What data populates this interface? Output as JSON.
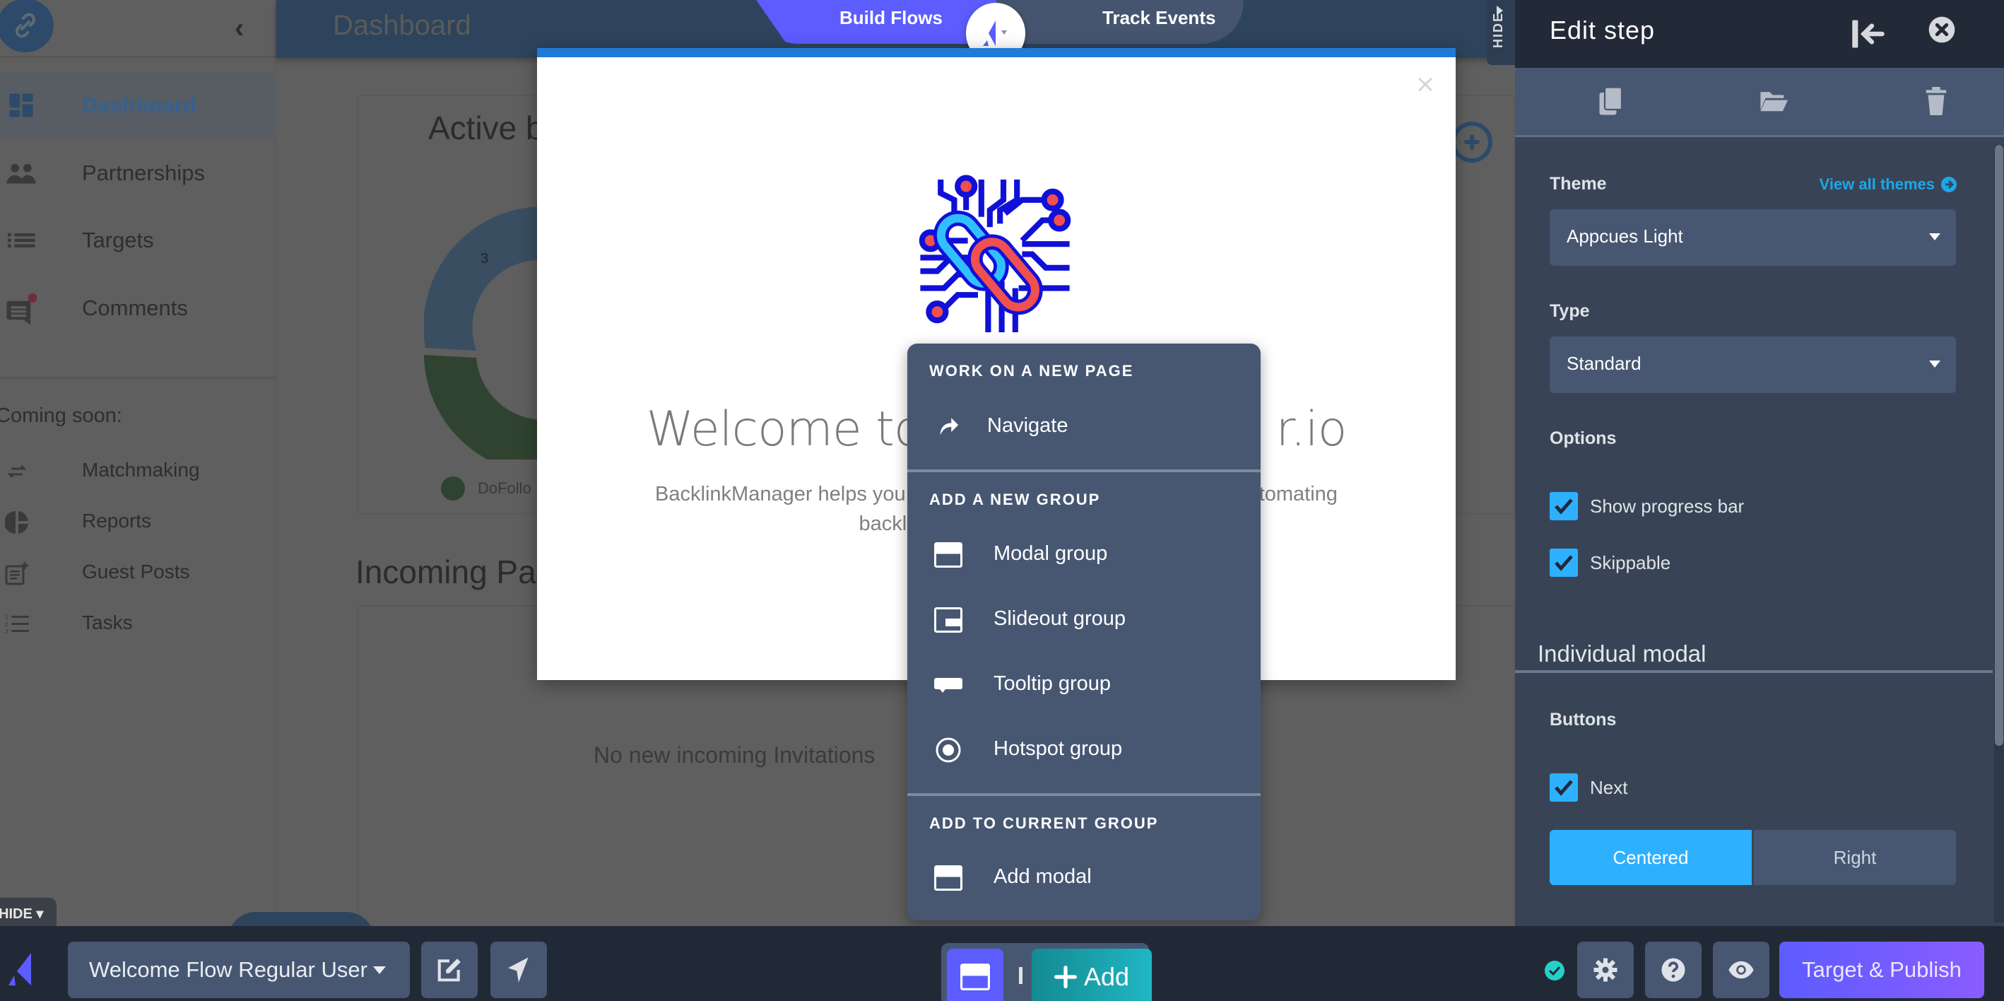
{
  "app": {
    "page_title": "Dashboard",
    "sidebar": {
      "items": [
        {
          "label": "Dashboard",
          "icon": "dashboard-icon",
          "active": true
        },
        {
          "label": "Partnerships",
          "icon": "people-icon"
        },
        {
          "label": "Targets",
          "icon": "list-icon"
        },
        {
          "label": "Comments",
          "icon": "comment-icon",
          "badge": true
        }
      ],
      "coming_soon_label": "Coming soon:",
      "coming_soon": [
        {
          "label": "Matchmaking",
          "icon": "swap-arrows-icon"
        },
        {
          "label": "Reports",
          "icon": "pie-chart-icon"
        },
        {
          "label": "Guest Posts",
          "icon": "post-add-icon"
        },
        {
          "label": "Tasks",
          "icon": "numbered-list-icon"
        }
      ]
    },
    "active_card": {
      "title_visible": "Active b",
      "donut_label": "3",
      "legend_visible": "DoFollo"
    },
    "incoming": {
      "title_visible": "Incoming Pa",
      "empty_text": "No new incoming Invitations"
    },
    "hide_label": "HIDE"
  },
  "mode_switch": {
    "build": "Build Flows",
    "track": "Track Events"
  },
  "welcome_modal": {
    "close": "×",
    "heading_left": "Welcome to",
    "heading_right": "r.io",
    "body_left": "BacklinkManager helps you",
    "body_right": "tomating",
    "body_line2": "backlink b"
  },
  "add_menu": {
    "sections": [
      {
        "title": "WORK ON A NEW PAGE",
        "items": [
          {
            "label": "Navigate",
            "icon": "navigate-arrow-icon"
          }
        ]
      },
      {
        "title": "ADD A NEW GROUP",
        "items": [
          {
            "label": "Modal group",
            "icon": "modal-icon"
          },
          {
            "label": "Slideout group",
            "icon": "slideout-icon"
          },
          {
            "label": "Tooltip group",
            "icon": "tooltip-icon"
          },
          {
            "label": "Hotspot group",
            "icon": "hotspot-icon"
          }
        ]
      },
      {
        "title": "ADD TO CURRENT GROUP",
        "items": [
          {
            "label": "Add modal",
            "icon": "modal-icon"
          }
        ]
      }
    ]
  },
  "edit_panel": {
    "hide_label": "HIDE",
    "title": "Edit step",
    "theme_label": "Theme",
    "view_all_themes": "View all themes",
    "theme_value": "Appcues Light",
    "type_label": "Type",
    "type_value": "Standard",
    "options_label": "Options",
    "options": [
      {
        "label": "Show progress bar",
        "checked": true
      },
      {
        "label": "Skippable",
        "checked": true
      }
    ],
    "section_heading": "Individual modal",
    "buttons_label": "Buttons",
    "buttons": [
      {
        "label": "Next",
        "checked": true
      }
    ],
    "alignment": {
      "options": [
        "Centered",
        "Right"
      ],
      "selected": "Centered"
    }
  },
  "bottom_bar": {
    "flow_name": "Welcome Flow Regular User",
    "add_label": "Add",
    "publish_label": "Target & Publish"
  },
  "colors": {
    "brand_purple": "#5c5cff",
    "accent_blue": "#2db1ff",
    "teal": "#20b6c4",
    "panel_dark": "#222937"
  }
}
